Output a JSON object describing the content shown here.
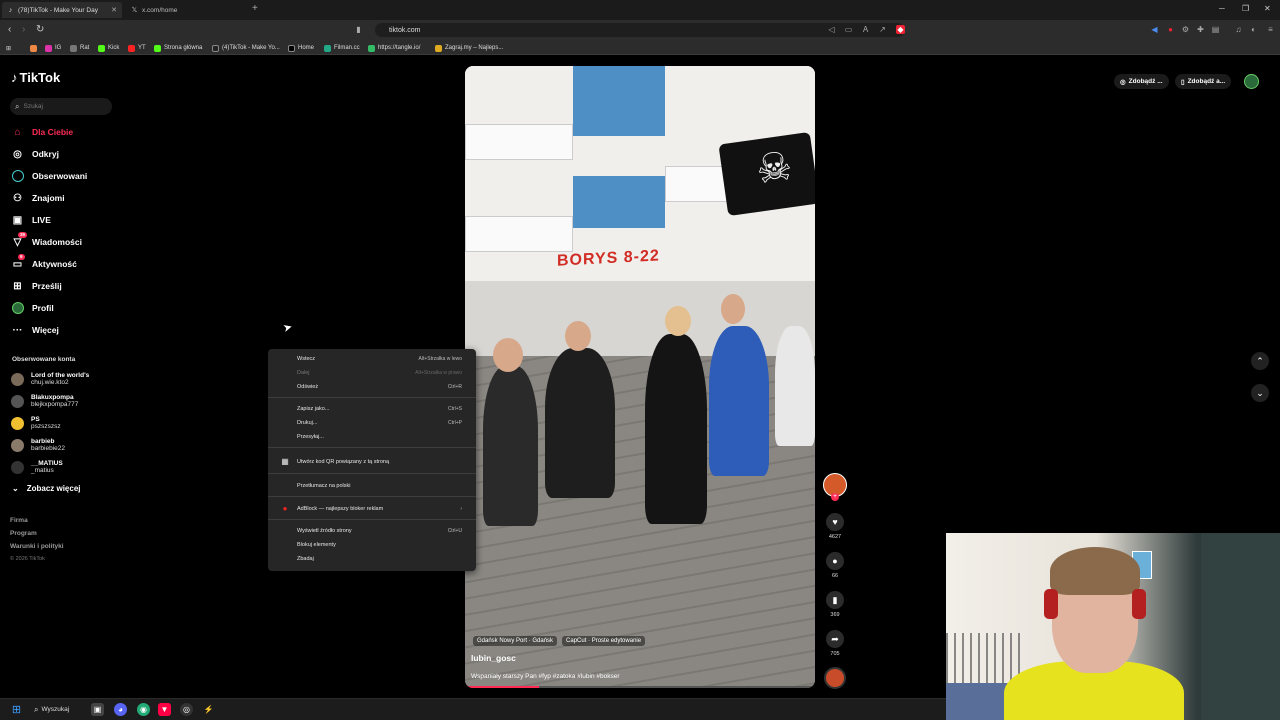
{
  "browser": {
    "tabs": [
      {
        "title": "(78)TikTok - Make Your Day",
        "active": true
      },
      {
        "title": "x.com/home",
        "active": false
      }
    ],
    "url": "tiktok.com",
    "bookmarks": [
      "IG",
      "Rat",
      "Kick",
      "YT",
      "Strona główna",
      "(4)TikTok - Make Yo...",
      "Home",
      "Filman.cc",
      "https://tangle.io/",
      "Zagraj.my – Najleps..."
    ]
  },
  "tiktok": {
    "logo": "TikTok",
    "search_placeholder": "Szukaj",
    "nav": [
      {
        "label": "Dla Ciebie",
        "icon": "home-icon",
        "active": true
      },
      {
        "label": "Odkryj",
        "icon": "compass-icon"
      },
      {
        "label": "Obserwowani",
        "icon": "following-icon"
      },
      {
        "label": "Znajomi",
        "icon": "friends-icon"
      },
      {
        "label": "LIVE",
        "icon": "live-icon"
      },
      {
        "label": "Wiadomości",
        "icon": "messages-icon",
        "badge": "39"
      },
      {
        "label": "Aktywność",
        "icon": "activity-icon",
        "badge": "9"
      },
      {
        "label": "Prześlij",
        "icon": "upload-icon"
      },
      {
        "label": "Profil",
        "icon": "profile-icon"
      },
      {
        "label": "Więcej",
        "icon": "more-icon"
      }
    ],
    "followed_title": "Obserwowane konta",
    "followed": [
      {
        "name": "Lord of the world's",
        "handle": "chuj.wie.kto2"
      },
      {
        "name": "Blakuxpompa",
        "handle": "blejkxpompa777"
      },
      {
        "name": "PS",
        "handle": "pszszszsz"
      },
      {
        "name": "barbieb",
        "handle": "barbiebie22"
      },
      {
        "name": "__MATIUS",
        "handle": "_matius"
      }
    ],
    "see_more": "Zobacz więcej",
    "footer": [
      "Firma",
      "Program",
      "Warunki i polityki"
    ],
    "copyright": "© 2026 TikTok",
    "top_buttons": [
      "Zdobądź ...",
      "Zdobądź a..."
    ],
    "video": {
      "sign_text": "BORYS 8-22",
      "tags": [
        "Gdańsk Nowy Port · Gdańsk",
        "CapCut · Proste edytowanie"
      ],
      "author": "lubin_gosc",
      "description": "Wspaniały starszy Pan #fyp #zatoka #lubin #bokser",
      "progress": 0.21
    },
    "actions": [
      {
        "icon": "heart-icon",
        "count": "4627"
      },
      {
        "icon": "comment-icon",
        "count": "66"
      },
      {
        "icon": "bookmark-icon",
        "count": "369"
      },
      {
        "icon": "share-icon",
        "count": "705"
      }
    ]
  },
  "context_menu": {
    "items": [
      {
        "label": "Wstecz",
        "shortcut": "Alt+Strzałka w lewo"
      },
      {
        "label": "Dalej",
        "shortcut": "Alt+Strzałka w prawo",
        "disabled": true
      },
      {
        "label": "Odśwież",
        "shortcut": "Ctrl+R"
      },
      {
        "label": "Zapisz jako...",
        "shortcut": "Ctrl+S"
      },
      {
        "label": "Drukuj...",
        "shortcut": "Ctrl+P"
      },
      {
        "label": "Przesyłaj...",
        "shortcut": ""
      },
      {
        "label": "Utwórz kod QR powiązany z tą stroną",
        "shortcut": ""
      },
      {
        "label": "Przetłumacz na polski",
        "shortcut": ""
      },
      {
        "label": "AdBlock — najlepszy bloker reklam",
        "shortcut": "›"
      },
      {
        "label": "Wyświetl źródło strony",
        "shortcut": "Ctrl+U"
      },
      {
        "label": "Blokuj elementy",
        "shortcut": ""
      },
      {
        "label": "Zbadaj",
        "shortcut": ""
      }
    ]
  },
  "taskbar": {
    "search_label": "Wyszukaj"
  }
}
